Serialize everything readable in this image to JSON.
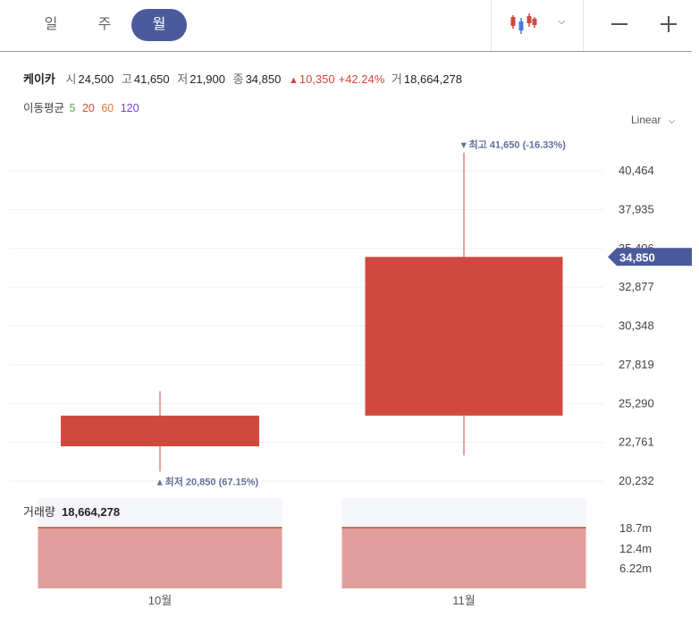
{
  "periods": {
    "items": [
      "일",
      "주",
      "월"
    ],
    "active_index": 2
  },
  "toolbar": {
    "chart_type_icon": "candlestick-icon",
    "dropdown_icon": "chevron-down-icon",
    "zoom_out_icon": "minus-icon",
    "zoom_in_icon": "plus-icon"
  },
  "info": {
    "name": "케이카",
    "open_label": "시",
    "open": "24,500",
    "high_label": "고",
    "high": "41,650",
    "low_label": "저",
    "low": "21,900",
    "close_label": "종",
    "close": "34,850",
    "change_arrow": "▲",
    "change": "10,350",
    "change_pct": "+42.24%",
    "volume_label": "거",
    "volume": "18,664,278"
  },
  "ma": {
    "label": "이동평균",
    "periods": [
      {
        "value": "5",
        "color": "#6aa84f"
      },
      {
        "value": "20",
        "color": "#d0493f"
      },
      {
        "value": "60",
        "color": "#e07b39"
      },
      {
        "value": "120",
        "color": "#7b3fd6"
      }
    ]
  },
  "scale_label": "Linear",
  "colors": {
    "up": "#d0493f",
    "up_volume": "#e09e9c",
    "accent": "#4b5a9c",
    "annotation": "#5f7199"
  },
  "chart_data": {
    "type": "candlestick",
    "categories": [
      "10월",
      "11월"
    ],
    "candles": [
      {
        "x": "10월",
        "open": 22500,
        "high": 26100,
        "low": 20850,
        "close": 24500
      },
      {
        "x": "11월",
        "open": 24500,
        "high": 41650,
        "low": 21900,
        "close": 34850
      }
    ],
    "y_ticks": [
      "40,464",
      "37,935",
      "35,406",
      "32,877",
      "30,348",
      "27,819",
      "25,290",
      "22,761",
      "20,232"
    ],
    "ylim": [
      20232,
      41650
    ],
    "last_price_label": "34,850",
    "last_price": 34850,
    "annotations": [
      {
        "text": "▾ 최고 41,650 (-16.33%)",
        "value": 41650,
        "candle": 1,
        "side": "above"
      },
      {
        "text": "▴ 최저 20,850 (67.15%)",
        "value": 20850,
        "candle": 0,
        "side": "below"
      }
    ],
    "volume": {
      "title": "거래량",
      "value_label": "18,664,278",
      "values": [
        18664278,
        18664278
      ],
      "ticks": [
        "18.7m",
        "12.4m",
        "6.22m"
      ],
      "max": 18664278
    }
  }
}
